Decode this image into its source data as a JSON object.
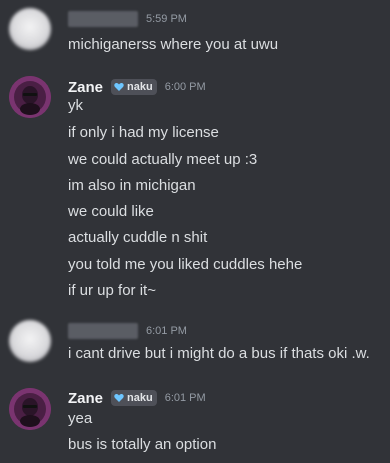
{
  "messages": [
    {
      "author": "",
      "timestamp": "5:59 PM",
      "lines": [
        "michiganerss where you at uwu"
      ]
    },
    {
      "author": "Zane",
      "tag": "naku",
      "timestamp": "6:00 PM",
      "lines": [
        "yk",
        "if only i had my license",
        "we could actually meet up :3",
        "im also in michigan",
        "we could like",
        "actually cuddle n shit",
        "you told me you liked cuddles hehe",
        "if ur up for it~"
      ]
    },
    {
      "author": "",
      "timestamp": "6:01 PM",
      "lines": [
        "i cant drive but i might do a bus if thats oki .w."
      ]
    },
    {
      "author": "Zane",
      "tag": "naku",
      "timestamp": "6:01 PM",
      "lines": [
        "yea",
        "bus is totally an option"
      ]
    }
  ],
  "colors": {
    "background": "#313338",
    "tag_heart": "#6ec6ff",
    "text": "#dbdee1",
    "timestamp": "#949ba4"
  }
}
